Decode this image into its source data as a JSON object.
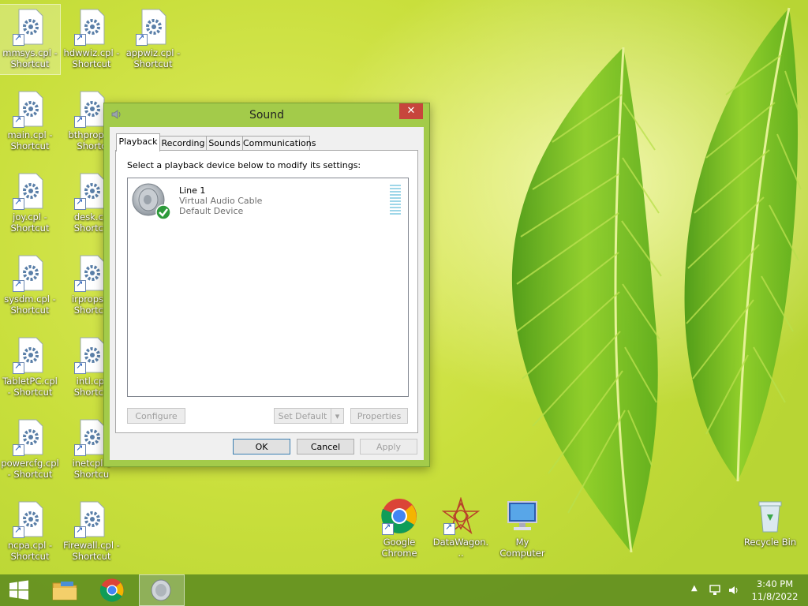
{
  "desktop": {
    "icons": [
      {
        "label": "mmsys.cpl - Shortcut"
      },
      {
        "label": "hdwwiz.cpl - Shortcut"
      },
      {
        "label": "appwiz.cpl - Shortcut"
      },
      {
        "label": "main.cpl - Shortcut"
      },
      {
        "label": "bthprops - Shortc"
      },
      {
        "label": "joy.cpl - Shortcut"
      },
      {
        "label": "desk.cp Shortcu"
      },
      {
        "label": "sysdm.cpl - Shortcut"
      },
      {
        "label": "irprops.c Shortcu"
      },
      {
        "label": "TabletPC.cpl - Shortcut"
      },
      {
        "label": "intl.cpl Shortcu"
      },
      {
        "label": "powercfg.cpl - Shortcut"
      },
      {
        "label": "inetcpl.c Shortcu"
      },
      {
        "label": "ncpa.cpl - Shortcut"
      },
      {
        "label": "Firewall.cpl - Shortcut"
      },
      {
        "label": "Google Chrome"
      },
      {
        "label": "DataWagon..."
      },
      {
        "label": "My Computer"
      },
      {
        "label": "Recycle Bin"
      }
    ]
  },
  "dialog": {
    "title": "Sound",
    "close_label": "✕",
    "tabs": [
      "Playback",
      "Recording",
      "Sounds",
      "Communications"
    ],
    "instruction": "Select a playback device below to modify its settings:",
    "device": {
      "name": "Line 1",
      "type": "Virtual Audio Cable",
      "status": "Default Device"
    },
    "buttons": {
      "configure": "Configure",
      "set_default": "Set Default",
      "properties": "Properties",
      "ok": "OK",
      "cancel": "Cancel",
      "apply": "Apply"
    }
  },
  "taskbar": {
    "time": "3:40 PM",
    "date": "11/8/2022"
  },
  "icons": {
    "start": "windows-start-icon",
    "explorer": "file-explorer-icon",
    "chrome": "chrome-icon",
    "sound": "speaker-icon",
    "tray": [
      "show-hidden-icons-icon",
      "network-icon",
      "volume-icon"
    ]
  }
}
